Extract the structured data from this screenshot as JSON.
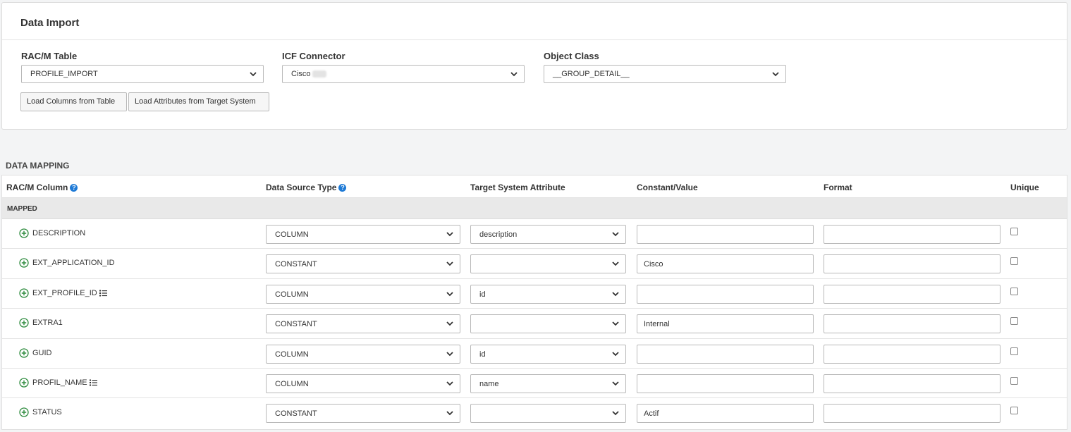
{
  "import_panel": {
    "title": "Data Import",
    "racm_table": {
      "label": "RAC/M Table",
      "value": "PROFILE_IMPORT"
    },
    "icf_connector": {
      "label": "ICF Connector",
      "value": "Cisco"
    },
    "object_class": {
      "label": "Object Class",
      "value": "__GROUP_DETAIL__"
    },
    "load_columns_button": "Load Columns from Table",
    "load_attributes_button": "Load Attributes from Target System"
  },
  "mapping": {
    "section_title": "DATA MAPPING",
    "headers": {
      "racm_column": "RAC/M Column",
      "data_source_type": "Data Source Type",
      "target_attribute": "Target System Attribute",
      "constant_value": "Constant/Value",
      "format": "Format",
      "unique": "Unique"
    },
    "group_label": "MAPPED",
    "rows": [
      {
        "name": "DESCRIPTION",
        "source_type": "COLUMN",
        "target": "description",
        "constant": "",
        "format": "",
        "list_icon": false
      },
      {
        "name": "EXT_APPLICATION_ID",
        "source_type": "CONSTANT",
        "target": "",
        "constant": "Cisco",
        "format": "",
        "list_icon": false
      },
      {
        "name": "EXT_PROFILE_ID",
        "source_type": "COLUMN",
        "target": "id",
        "constant": "",
        "format": "",
        "list_icon": true
      },
      {
        "name": "EXTRA1",
        "source_type": "CONSTANT",
        "target": "",
        "constant": "Internal",
        "format": "",
        "list_icon": false
      },
      {
        "name": "GUID",
        "source_type": "COLUMN",
        "target": "id",
        "constant": "",
        "format": "",
        "list_icon": false
      },
      {
        "name": "PROFIL_NAME",
        "source_type": "COLUMN",
        "target": "name",
        "constant": "",
        "format": "",
        "list_icon": true
      },
      {
        "name": "STATUS",
        "source_type": "CONSTANT",
        "target": "",
        "constant": "Actif",
        "format": "",
        "list_icon": false
      }
    ]
  },
  "colors": {
    "accent": "#1e7ad6",
    "plus_icon": "#2e8b3e"
  }
}
